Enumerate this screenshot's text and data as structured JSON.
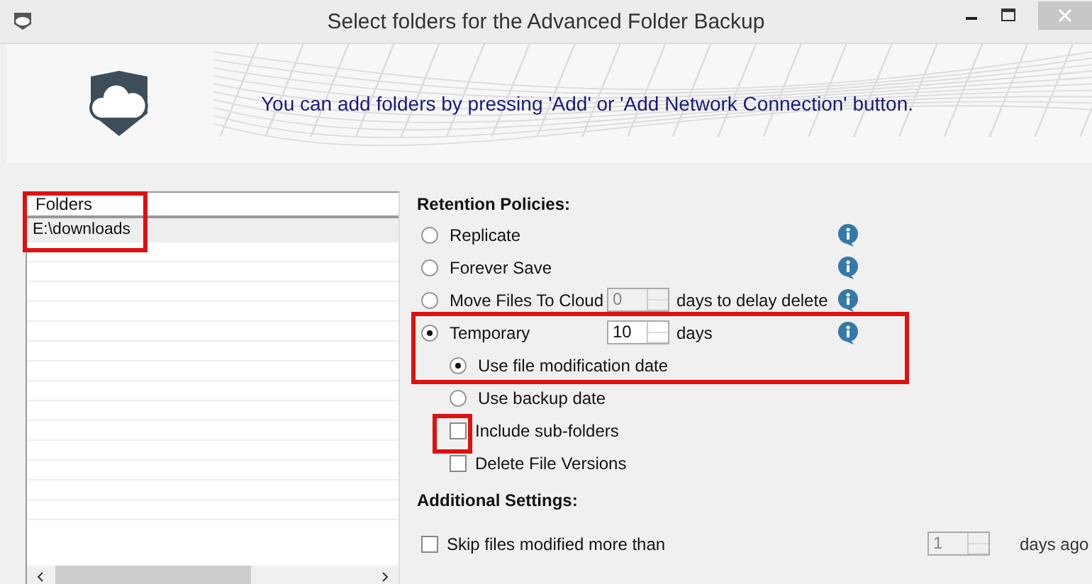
{
  "window": {
    "title": "Select folders for the Advanced Folder Backup"
  },
  "header": {
    "message": "You can add folders by pressing 'Add' or 'Add Network Connection' button."
  },
  "folders": {
    "column": "Folders",
    "rows": [
      {
        "path": "E:\\downloads",
        "selected": true
      }
    ]
  },
  "retention": {
    "heading": "Retention Policies:",
    "options": [
      {
        "label": "Replicate",
        "selected": false
      },
      {
        "label": "Forever Save",
        "selected": false
      },
      {
        "label": "Move Files To Cloud",
        "selected": false,
        "spin": {
          "value": "0",
          "disabled": true
        },
        "suffix": "days to delay delete"
      },
      {
        "label": "Temporary",
        "selected": true,
        "spin": {
          "value": "10",
          "disabled": false
        },
        "suffix": "days"
      }
    ],
    "date_options": [
      {
        "label": "Use file modification date",
        "selected": true
      },
      {
        "label": "Use backup date",
        "selected": false
      }
    ],
    "checks": [
      {
        "label": "Include sub-folders",
        "checked": false
      },
      {
        "label": "Delete File Versions",
        "checked": false
      }
    ]
  },
  "additional": {
    "heading": "Additional Settings:",
    "skip": {
      "label": "Skip files modified more than",
      "checked": false,
      "spin": {
        "value": "1",
        "disabled": true
      },
      "suffix": "days ago"
    }
  }
}
